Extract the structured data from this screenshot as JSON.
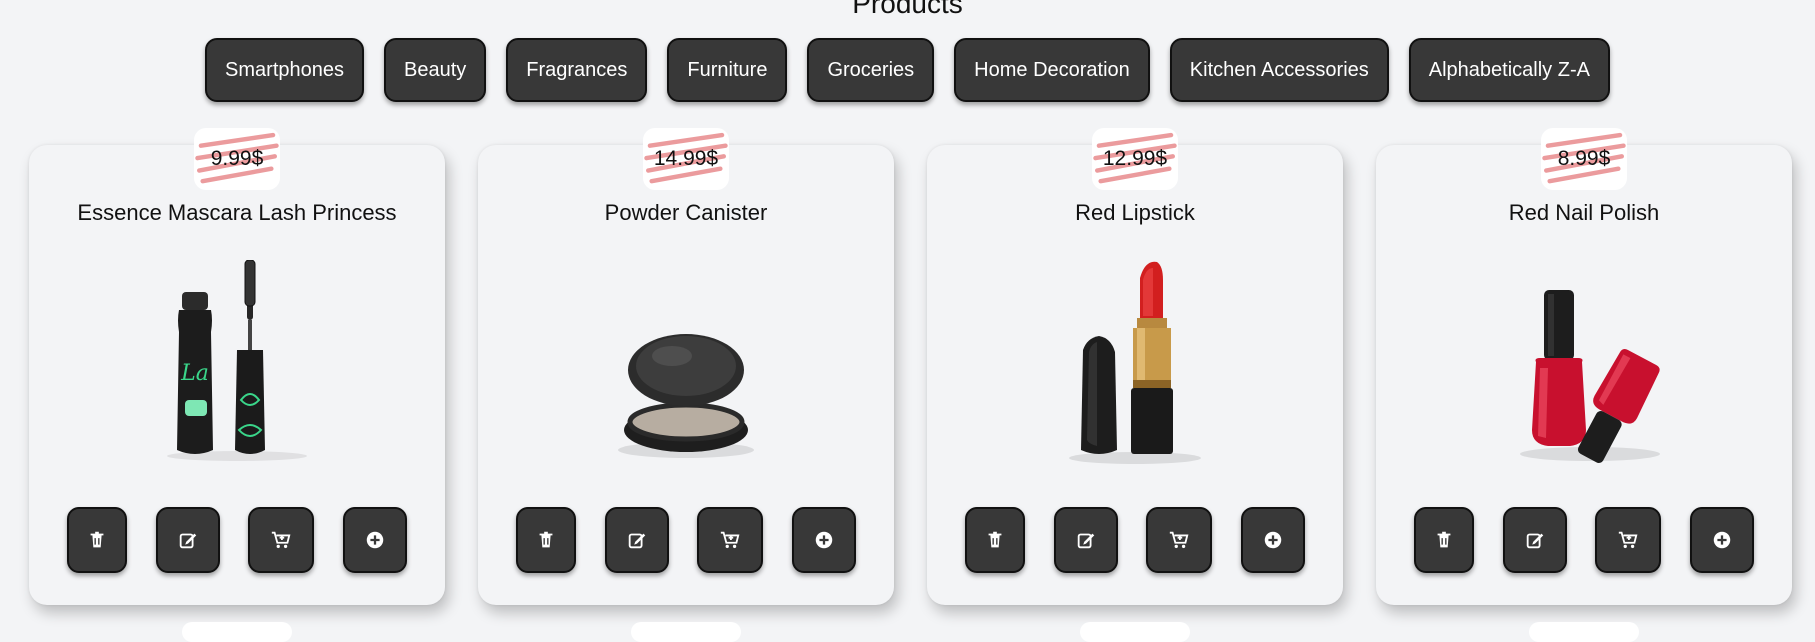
{
  "page": {
    "title": "Products"
  },
  "filters": [
    {
      "label": "Smartphones"
    },
    {
      "label": "Beauty"
    },
    {
      "label": "Fragrances"
    },
    {
      "label": "Furniture"
    },
    {
      "label": "Groceries"
    },
    {
      "label": "Home Decoration"
    },
    {
      "label": "Kitchen Accessories"
    },
    {
      "label": "Alphabetically Z-A"
    }
  ],
  "products": [
    {
      "price": "9.99$",
      "title": "Essence Mascara Lash Princess",
      "image": "mascara"
    },
    {
      "price": "14.99$",
      "title": "Powder Canister",
      "image": "powder-compact"
    },
    {
      "price": "12.99$",
      "title": "Red Lipstick",
      "image": "lipstick"
    },
    {
      "price": "8.99$",
      "title": "Red Nail Polish",
      "image": "nail-polish"
    }
  ],
  "card_actions": [
    "trash-icon",
    "edit-icon",
    "cart-plus-icon",
    "plus-circle-icon"
  ],
  "colors": {
    "button_bg": "#383838",
    "background": "#f3f4f6",
    "price_scribble": "#e8898c"
  }
}
